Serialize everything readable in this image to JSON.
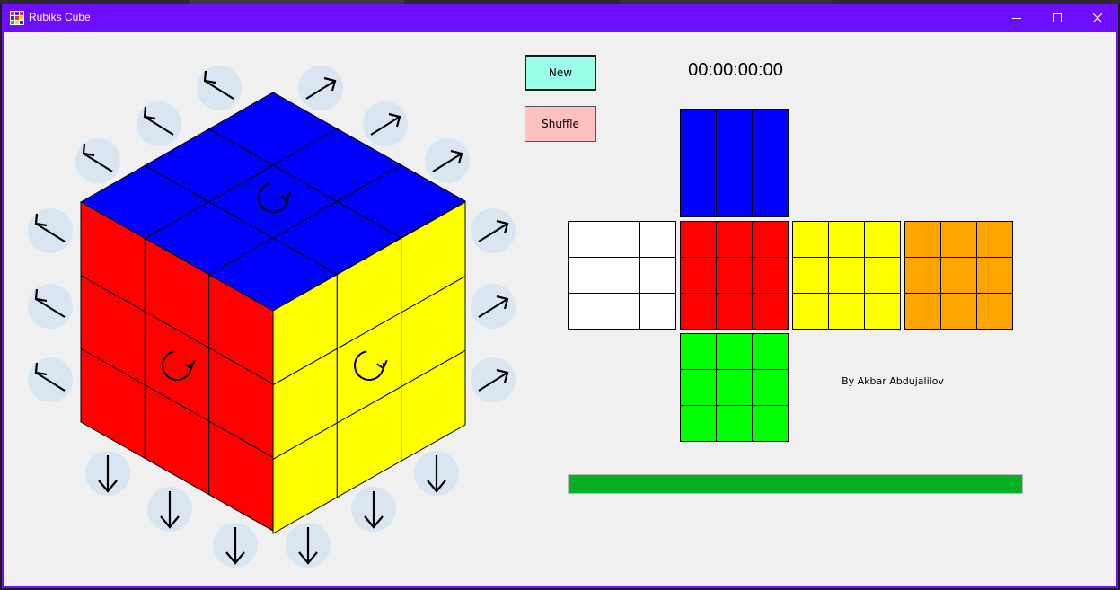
{
  "window": {
    "title": "Rubiks Cube",
    "app_icon": "rubiks-cube-icon",
    "controls": [
      {
        "name": "minimize-button",
        "icon": "minimize-icon"
      },
      {
        "name": "maximize-button",
        "icon": "maximize-icon"
      },
      {
        "name": "close-button",
        "icon": "close-icon"
      }
    ]
  },
  "controls": {
    "new_label": "New",
    "shuffle_label": "Shuffle",
    "timer": "00:00:00:00"
  },
  "author": "By Akbar Abdujalilov",
  "progress": {
    "fraction": 1.0,
    "color": "#06b025"
  },
  "colors": {
    "blue": "#0000ff",
    "red": "#ff0000",
    "yellow": "#ffff00",
    "white": "#ffffff",
    "orange": "#ffa500",
    "green": "#00ff00",
    "control_circle": "#d9e6f2",
    "window_accent": "#6d0eff"
  },
  "cube_faces": {
    "top": [
      "blue",
      "blue",
      "blue",
      "blue",
      "blue",
      "blue",
      "blue",
      "blue",
      "blue"
    ],
    "front": [
      "red",
      "red",
      "red",
      "red",
      "red",
      "red",
      "red",
      "red",
      "red"
    ],
    "right": [
      "yellow",
      "yellow",
      "yellow",
      "yellow",
      "yellow",
      "yellow",
      "yellow",
      "yellow",
      "yellow"
    ]
  },
  "rotate_icons": [
    "rotate-top-face-icon",
    "rotate-front-face-icon",
    "rotate-right-face-icon"
  ],
  "net": {
    "up": [
      "blue",
      "blue",
      "blue",
      "blue",
      "blue",
      "blue",
      "blue",
      "blue",
      "blue"
    ],
    "left": [
      "white",
      "white",
      "white",
      "white",
      "white",
      "white",
      "white",
      "white",
      "white"
    ],
    "front": [
      "red",
      "red",
      "red",
      "red",
      "red",
      "red",
      "red",
      "red",
      "red"
    ],
    "right": [
      "yellow",
      "yellow",
      "yellow",
      "yellow",
      "yellow",
      "yellow",
      "yellow",
      "yellow",
      "yellow"
    ],
    "back": [
      "orange",
      "orange",
      "orange",
      "orange",
      "orange",
      "orange",
      "orange",
      "orange",
      "orange"
    ],
    "down": [
      "green",
      "green",
      "green",
      "green",
      "green",
      "green",
      "green",
      "green",
      "green"
    ]
  },
  "move_buttons": {
    "left_column": [
      "arrow-up-left",
      "arrow-up-left",
      "arrow-up-left"
    ],
    "top_left_diagonal": [
      "arrow-up-left",
      "arrow-up-left",
      "arrow-up-left"
    ],
    "top_right_diagonal": [
      "arrow-up-right",
      "arrow-up-right",
      "arrow-up-right"
    ],
    "right_column": [
      "arrow-up-right",
      "arrow-up-right",
      "arrow-up-right"
    ],
    "bottom_left": [
      "arrow-down",
      "arrow-down",
      "arrow-down"
    ],
    "bottom_right": [
      "arrow-down",
      "arrow-down",
      "arrow-down"
    ]
  }
}
